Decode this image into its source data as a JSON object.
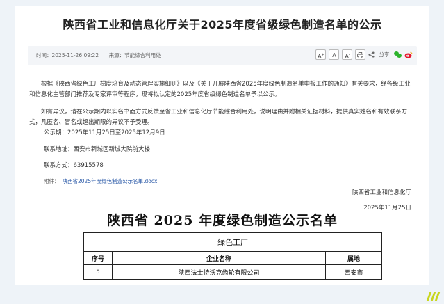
{
  "article": {
    "title": "陕西省工业和信息化厅关于2025年度省级绿色制造名单的公示",
    "time_label": "时间：",
    "time": "2025-11-26 09:22",
    "separator": "|",
    "source_label": "来源：",
    "source": "节能综合利用处",
    "font_buttons": [
      "A",
      "A",
      "A"
    ],
    "share_label": "分享:",
    "paragraph1": "根据《陕西省绿色工厂梯度培育及动态管理实施细则》以及《关于开展陕西省2025年度绿色制造名单申报工作的通知》有关要求，经各级工业和信息化主管部门推荐及专家评审等程序，现将拟认定的2025年度省级绿色制造名单予以公示。",
    "paragraph2": "如有异议，请在公示期内以实名书面方式反馈至省工业和信息化厅节能综合利用处，说明理由并附相关证据材料，提供真实姓名和有效联系方式，凡匿名、冒名或超出期限的异议不予受理。",
    "period": "公示期：2025年11月25日至2025年12月9日",
    "address": "联系地址：西安市新城区新城大院前大楼",
    "contact": "联系方式：63915578",
    "attachment_label": "附件：",
    "attachment": "陕西省2025年度绿色制造公示名单.docx",
    "signer": "陕西省工业和信息化厅",
    "sign_date": "2025年11月25日"
  },
  "document": {
    "title": "陕西省 2025 年度绿色制造公示名单",
    "category": "绿色工厂",
    "columns": [
      "序号",
      "企业名称",
      "属地"
    ],
    "rows": [
      [
        "5",
        "陕西法士特沃克齿轮有限公司",
        "西安市"
      ]
    ]
  },
  "icons": [
    "print-icon",
    "share-icon",
    "wechat-icon",
    "weibo-icon"
  ],
  "colors": {
    "link": "#2b5aa8",
    "wechat": "#2db32d",
    "weibo": "#e6162d"
  }
}
